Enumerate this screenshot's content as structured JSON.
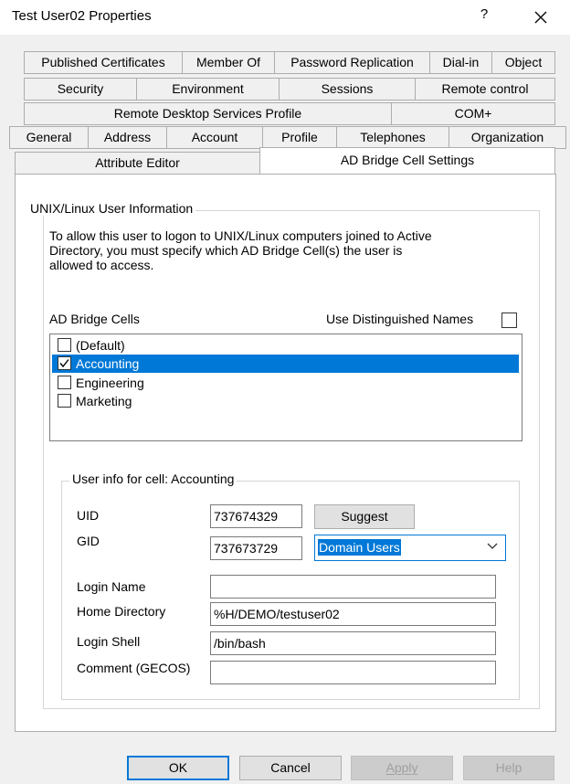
{
  "window": {
    "title": "Test User02 Properties",
    "help": "?"
  },
  "tabs": {
    "row1": [
      "Published Certificates",
      "Member Of",
      "Password Replication",
      "Dial-in",
      "Object"
    ],
    "row2": [
      "Security",
      "Environment",
      "Sessions",
      "Remote control"
    ],
    "row3": [
      "Remote Desktop Services Profile",
      "COM+"
    ],
    "row4": [
      "General",
      "Address",
      "Account",
      "Profile",
      "Telephones",
      "Organization"
    ],
    "row5": [
      "Attribute Editor",
      "AD Bridge Cell Settings"
    ],
    "active": "AD Bridge Cell Settings"
  },
  "unix_group": {
    "label": "UNIX/Linux User Information",
    "description_lines": [
      "To allow this user to logon to UNIX/Linux computers joined to Active",
      "Directory, you must specify which AD Bridge Cell(s) the user is",
      "allowed to access."
    ],
    "cells_label": "AD Bridge Cells",
    "use_dn_label": "Use Distinguished Names",
    "use_dn_checked": false,
    "cells": [
      {
        "name": "(Default)",
        "checked": false,
        "selected": false
      },
      {
        "name": "Accounting",
        "checked": true,
        "selected": true
      },
      {
        "name": "Engineering",
        "checked": false,
        "selected": false
      },
      {
        "name": "Marketing",
        "checked": false,
        "selected": false
      }
    ]
  },
  "cell_info": {
    "label": "User info for cell: Accounting",
    "uid_label": "UID",
    "uid": "737674329",
    "suggest": "Suggest",
    "gid_label": "GID",
    "gid": "737673729",
    "group_selected": "Domain Users",
    "login_name_label": "Login Name",
    "login_name": "",
    "home_dir_label": "Home Directory",
    "home_dir": "%H/DEMO/testuser02",
    "login_shell_label": "Login Shell",
    "login_shell": "/bin/bash",
    "comment_label": "Comment (GECOS)",
    "comment": ""
  },
  "buttons": {
    "ok": "OK",
    "cancel": "Cancel",
    "apply": "Apply",
    "help": "Help"
  },
  "colors": {
    "selection": "#0078d7",
    "face": "#f0f0f0"
  }
}
